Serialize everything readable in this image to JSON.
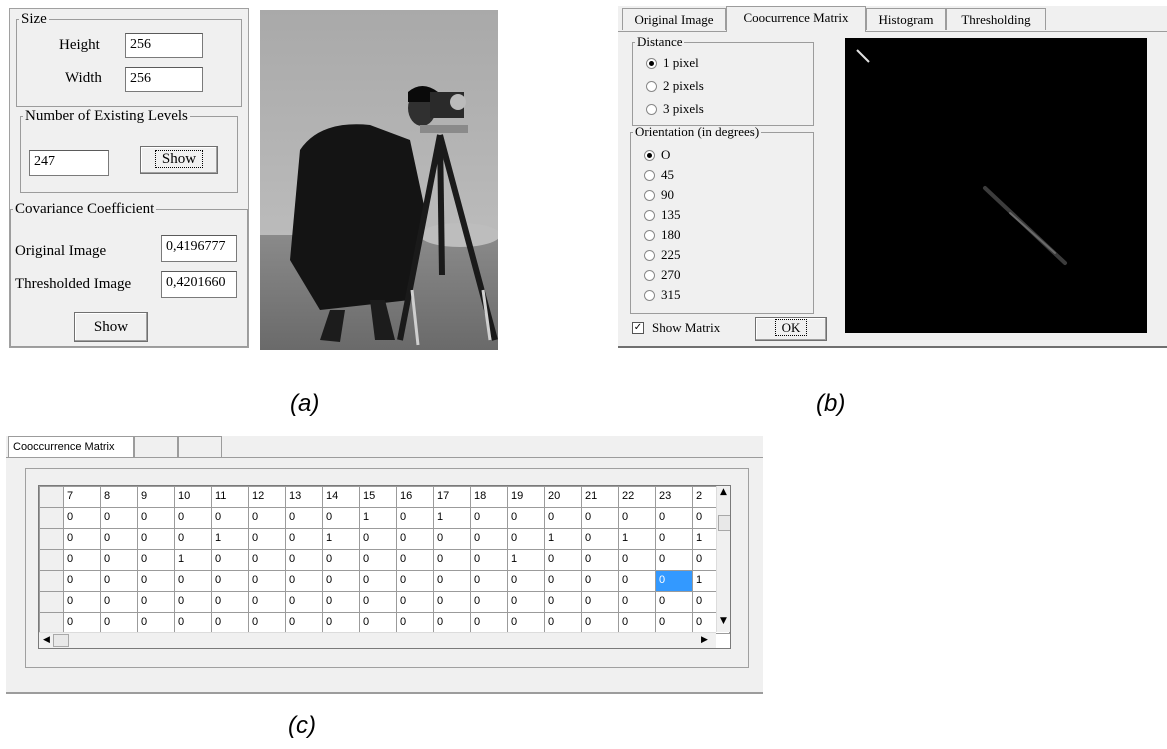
{
  "panel_a": {
    "size_group": {
      "legend": "Size",
      "height_label": "Height",
      "height_value": "256",
      "width_label": "Width",
      "width_value": "256"
    },
    "levels_group": {
      "legend": "Number of Existing Levels",
      "value": "247",
      "show_button": "Show"
    },
    "covariance_group": {
      "legend": "Covariance Coefficient",
      "original_label": "Original  Image",
      "original_value": "0,4196777",
      "thresholded_label": "Thresholded Image",
      "thresholded_value": "0,4201660",
      "show_button": "Show"
    }
  },
  "panel_b": {
    "tabs": [
      "Original Image",
      "Coocurrence Matrix",
      "Histogram",
      "Thresholding"
    ],
    "active_tab": 1,
    "distance": {
      "legend": "Distance",
      "options": [
        "1 pixel",
        "2 pixels",
        "3 pixels"
      ],
      "selected": 0
    },
    "orientation": {
      "legend": "Orientation (in degrees)",
      "options": [
        "O",
        "45",
        "90",
        "135",
        "180",
        "225",
        "270",
        "315"
      ],
      "selected": 0
    },
    "show_matrix_label": "Show Matrix",
    "show_matrix_checked": true,
    "ok_button": "OK"
  },
  "captions": {
    "a": "(a)",
    "b": "(b)",
    "c": "(c)"
  },
  "panel_c": {
    "tabs": [
      "Cooccurrence Matrix",
      "",
      ""
    ],
    "columns": [
      "7",
      "8",
      "9",
      "10",
      "11",
      "12",
      "13",
      "14",
      "15",
      "16",
      "17",
      "18",
      "19",
      "20",
      "21",
      "22",
      "23",
      "2"
    ],
    "rows": [
      [
        "0",
        "0",
        "0",
        "0",
        "0",
        "0",
        "0",
        "0",
        "1",
        "0",
        "1",
        "0",
        "0",
        "0",
        "0",
        "0",
        "0",
        "0"
      ],
      [
        "0",
        "0",
        "0",
        "0",
        "1",
        "0",
        "0",
        "1",
        "0",
        "0",
        "0",
        "0",
        "0",
        "1",
        "0",
        "1",
        "0",
        "1"
      ],
      [
        "0",
        "0",
        "0",
        "1",
        "0",
        "0",
        "0",
        "0",
        "0",
        "0",
        "0",
        "0",
        "1",
        "0",
        "0",
        "0",
        "0",
        "0"
      ],
      [
        "0",
        "0",
        "0",
        "0",
        "0",
        "0",
        "0",
        "0",
        "0",
        "0",
        "0",
        "0",
        "0",
        "0",
        "0",
        "0",
        "0",
        "1"
      ],
      [
        "0",
        "0",
        "0",
        "0",
        "0",
        "0",
        "0",
        "0",
        "0",
        "0",
        "0",
        "0",
        "0",
        "0",
        "0",
        "0",
        "0",
        "0"
      ],
      [
        "0",
        "0",
        "0",
        "0",
        "0",
        "0",
        "0",
        "0",
        "0",
        "0",
        "0",
        "0",
        "0",
        "0",
        "0",
        "0",
        "0",
        "0"
      ]
    ],
    "selected_cell": {
      "row": 3,
      "col": 16
    },
    "colors": {
      "selection": "#3399ff"
    }
  }
}
